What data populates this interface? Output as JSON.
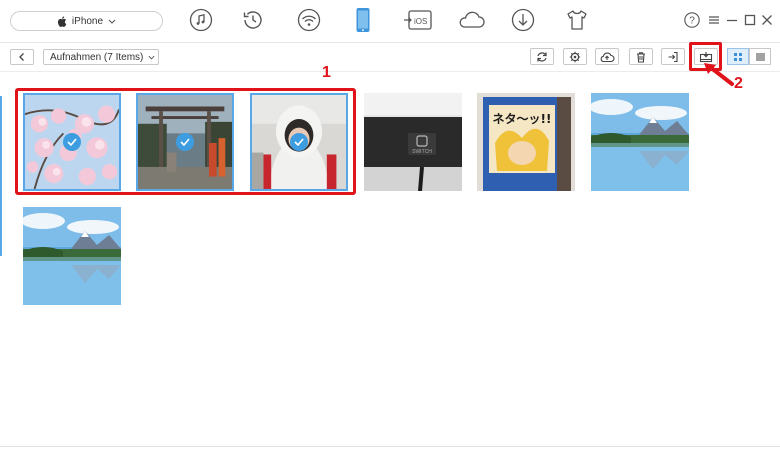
{
  "topbar": {
    "device_name": "iPhone",
    "nav_icons": [
      "apple-icon",
      "music-icon",
      "history-icon",
      "wifi-icon",
      "phone-icon",
      "ios-transfer-icon",
      "cloud-icon",
      "download-icon",
      "tshirt-icon"
    ],
    "ios_label": "iOS",
    "window_controls": [
      "help-icon",
      "menu-icon",
      "minimize-icon",
      "maximize-icon",
      "close-icon"
    ],
    "help_label": "?"
  },
  "toolbar": {
    "album_label": "Aufnahmen (7 Items)",
    "tools": [
      "refresh-icon",
      "settings-icon",
      "upload-icon",
      "delete-icon",
      "export-icon",
      "download-to-pc-icon",
      "grid-view-icon",
      "list-view-icon"
    ]
  },
  "photos": [
    {
      "subject": "cherry blossoms",
      "selected": true
    },
    {
      "subject": "shrine gate",
      "selected": true
    },
    {
      "subject": "person in hoodie",
      "selected": true
    },
    {
      "subject": "switch console",
      "selected": false
    },
    {
      "subject": "manga box",
      "selected": false
    },
    {
      "subject": "mountain lake",
      "selected": false
    },
    {
      "subject": "mountain lake",
      "selected": false
    }
  ],
  "photo_texts": {
    "switch_label": "SWITCH",
    "manga_title": "ネタ～ッ!!"
  },
  "annotations": {
    "label1": "1",
    "label2": "2"
  },
  "colors": {
    "accent": "#3d9de0",
    "annotation": "#e0121a",
    "selection": "#5aa7e8"
  }
}
